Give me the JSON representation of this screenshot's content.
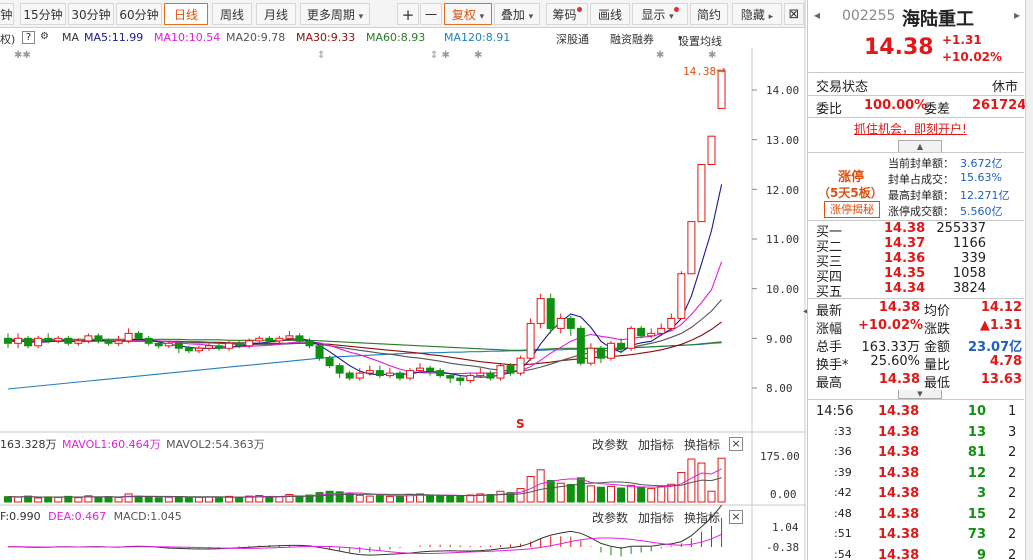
{
  "toolbar": {
    "left_items": [
      "钟",
      "15分钟",
      "30分钟",
      "60分钟"
    ],
    "active_period": "日线",
    "items": [
      "周线",
      "月线"
    ],
    "more_period": "更多周期",
    "plus": "+",
    "minus": "一",
    "fuquan": "复权",
    "diejia": "叠加",
    "chouma": "筹码",
    "huaxian": "画线",
    "xianshi": "显示",
    "jianyue": "简约",
    "yincang": "隐藏"
  },
  "ma_row": {
    "prefix": "权)",
    "question": "?",
    "ma": "MA",
    "ma5": "MA5:11.99",
    "ma10": "MA10:10.54",
    "ma20": "MA20:9.78",
    "ma30": "MA30:9.33",
    "ma60": "MA60:8.93",
    "ma120": "MA120:8.91",
    "shentong": "深股通",
    "rongzi": "融资融券",
    "setma": "设置均线"
  },
  "colors": {
    "up": "#e01818",
    "down": "#109010",
    "ma5": "#1a1a8c",
    "ma10": "#e020e0",
    "ma20": "#555555",
    "ma30": "#8b1010",
    "ma60": "#2a7a2a",
    "ma120": "#2080c0"
  },
  "price_axis": {
    "labels": [
      "14.00",
      "13.00",
      "12.00",
      "11.00",
      "10.00",
      "9.00",
      "8.00"
    ],
    "last_price_tag": "14.38"
  },
  "volume_panel": {
    "vol": "163.328万",
    "mavol1": "MAVOL1:60.464万",
    "mavol2": "MAVOL2:54.363万",
    "axis": [
      "175.00",
      "0.00"
    ],
    "buttons": [
      "改参数",
      "加指标",
      "换指标"
    ],
    "close": "×"
  },
  "macd_panel": {
    "dif": "F:0.990",
    "dea": "DEA:0.467",
    "macd": "MACD:1.045",
    "axis": [
      "1.04",
      "-0.38"
    ],
    "buttons": [
      "改参数",
      "加指标",
      "换指标"
    ],
    "close": "×"
  },
  "stock": {
    "code": "002255",
    "name": "海陆重工",
    "price": "14.38",
    "change": "+1.31",
    "pct": "+10.02%"
  },
  "status": {
    "label": "交易状态",
    "value": "休市"
  },
  "weibi": {
    "label1": "委比",
    "value1": "100.00%",
    "label2": "委差",
    "value2": "261724"
  },
  "ad_link": "抓住机会，即刻开户!",
  "limit_up": {
    "badge": "涨停",
    "days": "（5天5板）",
    "reveal_btn": "涨停揭秘",
    "items": [
      {
        "label": "当前封单额：",
        "value": "3.672亿"
      },
      {
        "label": "封单占成交：",
        "value": "15.63%"
      },
      {
        "label": "最高封单额：",
        "value": "12.271亿"
      },
      {
        "label": "涨停成交额：",
        "value": "5.560亿"
      }
    ]
  },
  "bids": [
    {
      "label": "买一",
      "price": "14.38",
      "vol": "255337"
    },
    {
      "label": "买二",
      "price": "14.37",
      "vol": "1166"
    },
    {
      "label": "买三",
      "price": "14.36",
      "vol": "339"
    },
    {
      "label": "买四",
      "price": "14.35",
      "vol": "1058"
    },
    {
      "label": "买五",
      "price": "14.34",
      "vol": "3824"
    }
  ],
  "quote": [
    {
      "l1": "最新",
      "v1": "14.38",
      "l2": "均价",
      "v2": "14.12",
      "c1": "red",
      "c2": "red"
    },
    {
      "l1": "涨幅",
      "v1": "+10.02%",
      "l2": "涨跌",
      "v2": "▲1.31",
      "c1": "red",
      "c2": "red"
    },
    {
      "l1": "总手",
      "v1": "163.33万",
      "l2": "金额",
      "v2": "23.07亿",
      "c1": "dark",
      "c2": "blue"
    },
    {
      "l1": "换手*",
      "v1": "25.60%",
      "l2": "量比",
      "v2": "4.78",
      "c1": "dark",
      "c2": "red"
    },
    {
      "l1": "最高",
      "v1": "14.38",
      "l2": "最低",
      "v2": "13.63",
      "c1": "red",
      "c2": "red"
    }
  ],
  "ticks": [
    {
      "time": "14:56",
      "price": "14.38",
      "vol": "10",
      "n": "1"
    },
    {
      "time": ":33",
      "price": "14.38",
      "vol": "13",
      "n": "3"
    },
    {
      "time": ":36",
      "price": "14.38",
      "vol": "81",
      "n": "2"
    },
    {
      "time": ":39",
      "price": "14.38",
      "vol": "12",
      "n": "2"
    },
    {
      "time": ":42",
      "price": "14.38",
      "vol": "3",
      "n": "2"
    },
    {
      "time": ":48",
      "price": "14.38",
      "vol": "15",
      "n": "2"
    },
    {
      "time": ":51",
      "price": "14.38",
      "vol": "73",
      "n": "2"
    },
    {
      "time": ":54",
      "price": "14.38",
      "vol": "9",
      "n": "2"
    }
  ],
  "chart_data": {
    "type": "candlestick",
    "ylim": [
      7.5,
      14.7
    ],
    "candles": [
      [
        9.0,
        8.9,
        9.1,
        8.8
      ],
      [
        8.9,
        9.0,
        9.1,
        8.8
      ],
      [
        9.0,
        8.85,
        9.05,
        8.8
      ],
      [
        8.85,
        9.0,
        9.05,
        8.8
      ],
      [
        9.0,
        8.95,
        9.1,
        8.9
      ],
      [
        8.95,
        9.0,
        9.05,
        8.9
      ],
      [
        9.0,
        8.9,
        9.05,
        8.85
      ],
      [
        8.9,
        8.95,
        9.0,
        8.85
      ],
      [
        8.95,
        9.05,
        9.1,
        8.9
      ],
      [
        9.05,
        8.95,
        9.1,
        8.9
      ],
      [
        8.95,
        8.9,
        9.0,
        8.85
      ],
      [
        8.9,
        8.95,
        9.05,
        8.85
      ],
      [
        8.95,
        9.1,
        9.2,
        8.9
      ],
      [
        9.1,
        9.0,
        9.15,
        8.95
      ],
      [
        9.0,
        8.9,
        9.05,
        8.85
      ],
      [
        8.9,
        8.85,
        8.95,
        8.8
      ],
      [
        8.85,
        8.9,
        8.95,
        8.8
      ],
      [
        8.9,
        8.8,
        8.95,
        8.7
      ],
      [
        8.8,
        8.75,
        8.85,
        8.7
      ],
      [
        8.75,
        8.8,
        8.85,
        8.7
      ],
      [
        8.8,
        8.85,
        8.9,
        8.75
      ],
      [
        8.85,
        8.8,
        8.9,
        8.75
      ],
      [
        8.8,
        8.9,
        8.95,
        8.75
      ],
      [
        8.9,
        8.85,
        8.95,
        8.8
      ],
      [
        8.85,
        8.95,
        9.0,
        8.8
      ],
      [
        8.95,
        9.0,
        9.05,
        8.9
      ],
      [
        9.0,
        8.95,
        9.05,
        8.9
      ],
      [
        8.95,
        9.0,
        9.05,
        8.9
      ],
      [
        9.0,
        9.05,
        9.15,
        8.95
      ],
      [
        9.05,
        8.95,
        9.1,
        8.9
      ],
      [
        8.95,
        8.85,
        9.0,
        8.8
      ],
      [
        8.85,
        8.6,
        8.9,
        8.55
      ],
      [
        8.6,
        8.45,
        8.65,
        8.4
      ],
      [
        8.45,
        8.3,
        8.5,
        8.2
      ],
      [
        8.3,
        8.2,
        8.35,
        8.15
      ],
      [
        8.2,
        8.3,
        8.4,
        8.15
      ],
      [
        8.3,
        8.35,
        8.45,
        8.25
      ],
      [
        8.35,
        8.25,
        8.45,
        8.2
      ],
      [
        8.25,
        8.3,
        8.4,
        8.2
      ],
      [
        8.3,
        8.2,
        8.35,
        8.15
      ],
      [
        8.2,
        8.35,
        8.4,
        8.15
      ],
      [
        8.35,
        8.4,
        8.5,
        8.3
      ],
      [
        8.4,
        8.35,
        8.45,
        8.25
      ],
      [
        8.35,
        8.25,
        8.4,
        8.2
      ],
      [
        8.25,
        8.2,
        8.3,
        8.1
      ],
      [
        8.2,
        8.15,
        8.25,
        8.05
      ],
      [
        8.15,
        8.25,
        8.3,
        8.1
      ],
      [
        8.25,
        8.3,
        8.4,
        8.2
      ],
      [
        8.3,
        8.2,
        8.35,
        8.15
      ],
      [
        8.2,
        8.45,
        8.5,
        8.15
      ],
      [
        8.45,
        8.3,
        8.5,
        8.25
      ],
      [
        8.3,
        8.6,
        8.65,
        8.25
      ],
      [
        8.6,
        9.3,
        9.4,
        8.55
      ],
      [
        9.3,
        9.8,
        9.9,
        9.2
      ],
      [
        9.8,
        9.2,
        9.9,
        9.1
      ],
      [
        9.2,
        9.4,
        9.5,
        9.1
      ],
      [
        9.4,
        9.2,
        9.45,
        9.05
      ],
      [
        9.2,
        8.5,
        9.25,
        8.45
      ],
      [
        8.5,
        8.8,
        8.9,
        8.45
      ],
      [
        8.8,
        8.6,
        8.85,
        8.5
      ],
      [
        8.6,
        8.9,
        8.95,
        8.55
      ],
      [
        8.9,
        8.8,
        9.0,
        8.7
      ],
      [
        8.8,
        9.2,
        9.25,
        8.75
      ],
      [
        9.2,
        9.05,
        9.25,
        9.0
      ],
      [
        9.05,
        9.1,
        9.2,
        9.0
      ],
      [
        9.1,
        9.2,
        9.3,
        9.05
      ],
      [
        9.2,
        9.4,
        9.5,
        9.15
      ],
      [
        9.4,
        10.3,
        10.35,
        9.4
      ],
      [
        10.3,
        11.35,
        11.35,
        10.3
      ],
      [
        11.35,
        12.5,
        12.5,
        11.9
      ],
      [
        12.5,
        13.07,
        13.07,
        13.07
      ],
      [
        13.63,
        14.38,
        14.38,
        13.63
      ]
    ],
    "volume": [
      20,
      18,
      22,
      15,
      19,
      17,
      21,
      16,
      23,
      18,
      20,
      17,
      30,
      22,
      19,
      16,
      18,
      20,
      15,
      17,
      19,
      16,
      21,
      18,
      22,
      24,
      19,
      20,
      28,
      22,
      26,
      35,
      40,
      38,
      30,
      25,
      22,
      24,
      20,
      23,
      28,
      30,
      25,
      22,
      24,
      21,
      26,
      30,
      28,
      40,
      35,
      50,
      95,
      120,
      80,
      70,
      65,
      90,
      60,
      55,
      58,
      52,
      62,
      55,
      50,
      58,
      66,
      110,
      160,
      145,
      40,
      163
    ],
    "ma5": [
      8.95,
      8.95,
      8.93,
      8.92,
      8.93,
      8.95,
      8.95,
      8.94,
      8.95,
      8.96,
      8.95,
      8.93,
      8.97,
      8.98,
      8.97,
      8.93,
      8.88,
      8.85,
      8.82,
      8.8,
      8.8,
      8.8,
      8.82,
      8.84,
      8.87,
      8.9,
      8.93,
      8.95,
      8.98,
      8.99,
      8.96,
      8.86,
      8.73,
      8.59,
      8.45,
      8.34,
      8.28,
      8.27,
      8.28,
      8.28,
      8.28,
      8.32,
      8.33,
      8.32,
      8.29,
      8.25,
      8.23,
      8.22,
      8.22,
      8.27,
      8.3,
      8.38,
      8.58,
      8.89,
      9.14,
      9.33,
      9.49,
      9.43,
      9.22,
      8.94,
      8.8,
      8.72,
      8.86,
      8.91,
      8.94,
      9.07,
      9.19,
      9.4,
      9.85,
      10.5,
      11.17,
      12.1
    ],
    "ma10": [
      8.95,
      8.95,
      8.94,
      8.93,
      8.94,
      8.94,
      8.94,
      8.94,
      8.94,
      8.95,
      8.95,
      8.94,
      8.95,
      8.96,
      8.96,
      8.95,
      8.93,
      8.91,
      8.89,
      8.88,
      8.86,
      8.84,
      8.84,
      8.83,
      8.84,
      8.85,
      8.86,
      8.88,
      8.91,
      8.93,
      8.93,
      8.91,
      8.86,
      8.79,
      8.72,
      8.67,
      8.6,
      8.53,
      8.45,
      8.38,
      8.33,
      8.31,
      8.3,
      8.3,
      8.29,
      8.29,
      8.3,
      8.3,
      8.3,
      8.31,
      8.32,
      8.35,
      8.43,
      8.56,
      8.7,
      8.82,
      8.94,
      9.02,
      9.08,
      9.04,
      9.01,
      8.97,
      9.0,
      9.02,
      9.04,
      9.09,
      9.15,
      9.28,
      9.48,
      9.72,
      9.98,
      10.54
    ],
    "ma20": [
      8.94,
      8.94,
      8.94,
      8.94,
      8.94,
      8.94,
      8.94,
      8.94,
      8.94,
      8.94,
      8.95,
      8.94,
      8.94,
      8.94,
      8.94,
      8.94,
      8.94,
      8.93,
      8.92,
      8.91,
      8.91,
      8.9,
      8.89,
      8.88,
      8.88,
      8.88,
      8.88,
      8.88,
      8.89,
      8.9,
      8.9,
      8.88,
      8.85,
      8.82,
      8.79,
      8.76,
      8.73,
      8.7,
      8.68,
      8.65,
      8.62,
      8.6,
      8.57,
      8.54,
      8.5,
      8.47,
      8.45,
      8.42,
      8.38,
      8.36,
      8.34,
      8.34,
      8.37,
      8.42,
      8.48,
      8.55,
      8.61,
      8.67,
      8.71,
      8.74,
      8.76,
      8.78,
      8.82,
      8.86,
      8.9,
      8.95,
      9.02,
      9.1,
      9.22,
      9.38,
      9.55,
      9.78
    ],
    "ma30": [
      8.95,
      8.95,
      8.95,
      8.95,
      8.95,
      8.95,
      8.95,
      8.95,
      8.95,
      8.95,
      8.95,
      8.95,
      8.95,
      8.95,
      8.95,
      8.94,
      8.94,
      8.94,
      8.93,
      8.93,
      8.92,
      8.92,
      8.91,
      8.91,
      8.91,
      8.9,
      8.9,
      8.9,
      8.9,
      8.9,
      8.9,
      8.89,
      8.88,
      8.86,
      8.84,
      8.82,
      8.8,
      8.78,
      8.76,
      8.74,
      8.72,
      8.7,
      8.67,
      8.65,
      8.62,
      8.59,
      8.56,
      8.53,
      8.51,
      8.49,
      8.47,
      8.47,
      8.48,
      8.5,
      8.52,
      8.55,
      8.57,
      8.59,
      8.61,
      8.62,
      8.63,
      8.65,
      8.67,
      8.7,
      8.73,
      8.77,
      8.82,
      8.88,
      8.96,
      9.06,
      9.18,
      9.33
    ],
    "ma60": [
      8.98,
      8.98,
      8.98,
      8.98,
      8.98,
      8.98,
      8.98,
      8.98,
      8.98,
      8.98,
      8.98,
      8.98,
      8.98,
      8.98,
      8.98,
      8.98,
      8.98,
      8.98,
      8.97,
      8.97,
      8.97,
      8.97,
      8.96,
      8.96,
      8.96,
      8.96,
      8.96,
      8.96,
      8.96,
      8.96,
      8.96,
      8.95,
      8.94,
      8.93,
      8.92,
      8.91,
      8.9,
      8.89,
      8.88,
      8.87,
      8.86,
      8.85,
      8.84,
      8.83,
      8.82,
      8.81,
      8.8,
      8.79,
      8.78,
      8.77,
      8.76,
      8.76,
      8.77,
      8.78,
      8.79,
      8.8,
      8.8,
      8.8,
      8.8,
      8.8,
      8.8,
      8.8,
      8.81,
      8.82,
      8.83,
      8.84,
      8.85,
      8.86,
      8.87,
      8.89,
      8.91,
      8.93
    ],
    "ma120": [
      7.98,
      8.0,
      8.02,
      8.04,
      8.06,
      8.08,
      8.1,
      8.12,
      8.14,
      8.16,
      8.18,
      8.2,
      8.22,
      8.24,
      8.26,
      8.28,
      8.3,
      8.32,
      8.34,
      8.36,
      8.38,
      8.4,
      8.42,
      8.44,
      8.46,
      8.48,
      8.5,
      8.52,
      8.54,
      8.56,
      8.58,
      8.6,
      8.62,
      8.63,
      8.64,
      8.65,
      8.66,
      8.67,
      8.68,
      8.69,
      8.7,
      8.7,
      8.71,
      8.71,
      8.72,
      8.72,
      8.73,
      8.73,
      8.74,
      8.74,
      8.75,
      8.75,
      8.76,
      8.76,
      8.77,
      8.77,
      8.78,
      8.78,
      8.79,
      8.79,
      8.8,
      8.8,
      8.81,
      8.82,
      8.83,
      8.84,
      8.85,
      8.86,
      8.87,
      8.88,
      8.9,
      8.91
    ]
  }
}
